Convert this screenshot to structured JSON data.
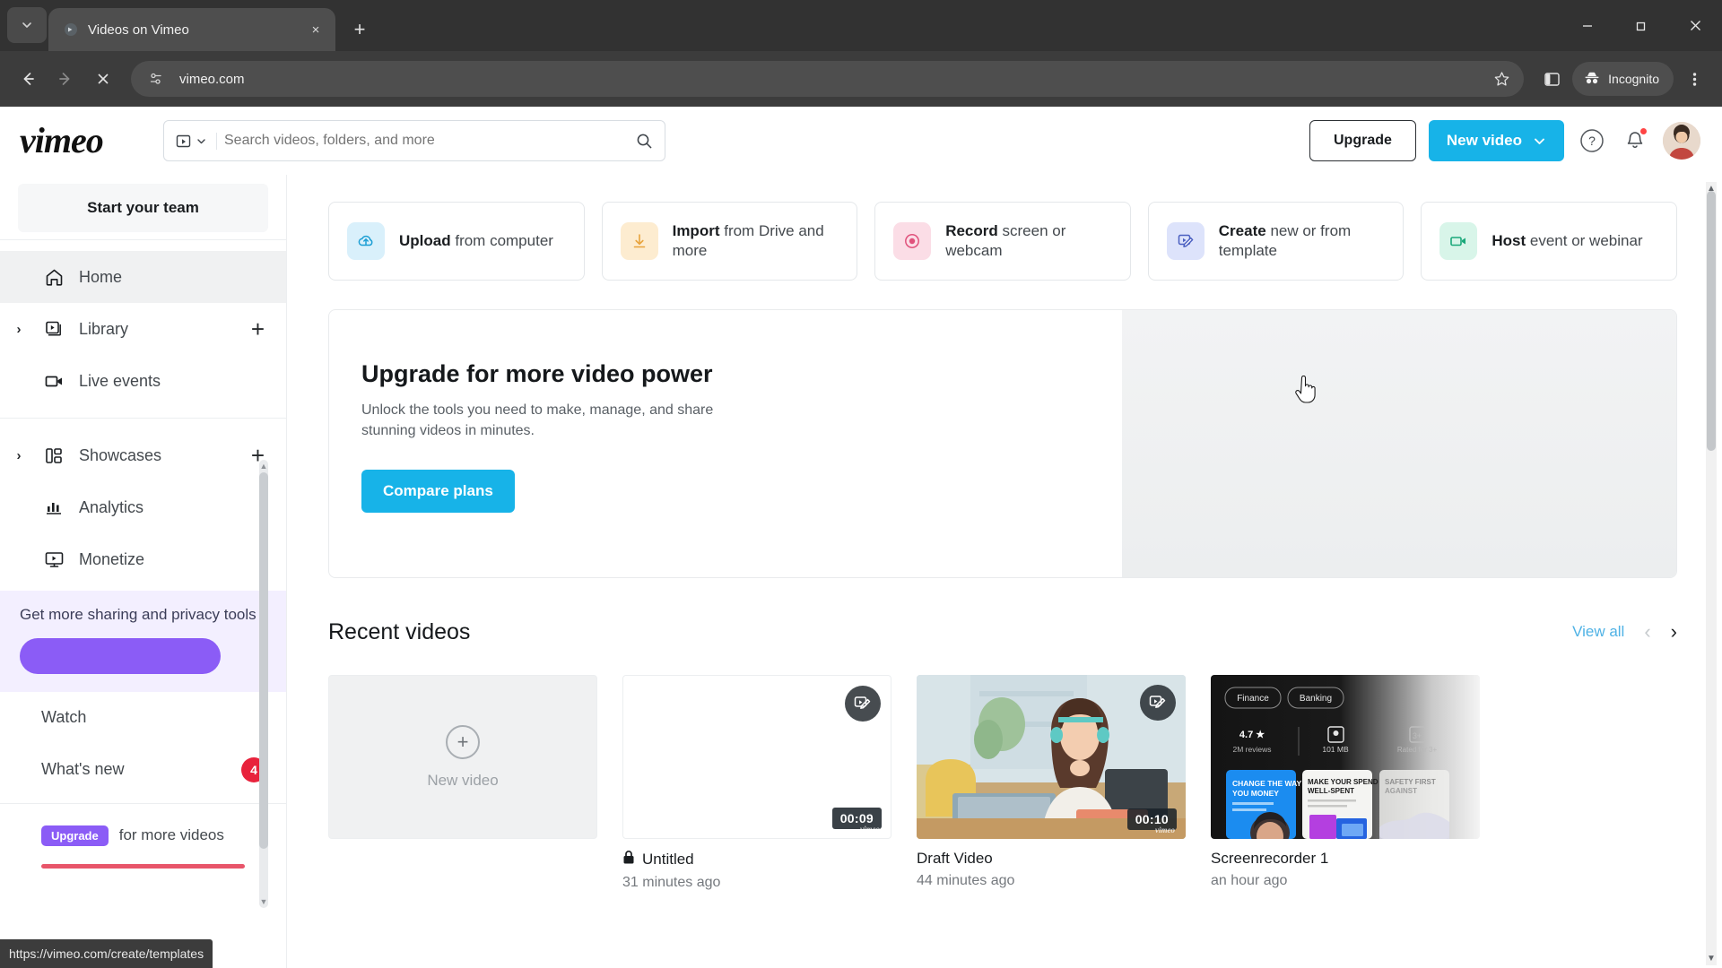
{
  "browser": {
    "tab": {
      "title": "Videos on Vimeo",
      "close_label": "×"
    },
    "new_tab_label": "+",
    "tab_search_label": "⌄",
    "window": {
      "minimize": "—",
      "maximize": "❐",
      "close": "✕"
    },
    "nav": {
      "back": "←",
      "forward": "→",
      "stop": "✕"
    },
    "omnibox": {
      "url": "vimeo.com",
      "site_info_icon": "site-settings-icon"
    },
    "toolbar": {
      "bookmark_icon": "star-icon",
      "sidepanel_icon": "side-panel-icon",
      "incognito_label": "Incognito",
      "menu_icon": "three-dot-menu-icon"
    },
    "status_url": "https://vimeo.com/create/templates"
  },
  "header": {
    "logo": "vimeo",
    "search": {
      "placeholder": "Search videos, folders, and more",
      "value": ""
    },
    "upgrade_label": "Upgrade",
    "new_video_label": "New video",
    "help_icon": "question-mark-icon",
    "notifications_icon": "bell-icon"
  },
  "sidebar": {
    "start_team_label": "Start your team",
    "items": [
      {
        "label": "Home",
        "icon": "home-icon",
        "active": true,
        "caret": false,
        "plus": false
      },
      {
        "label": "Library",
        "icon": "library-icon",
        "active": false,
        "caret": true,
        "plus": true
      },
      {
        "label": "Live events",
        "icon": "video-camera-icon",
        "active": false,
        "caret": false,
        "plus": false
      },
      {
        "label": "Showcases",
        "icon": "showcases-icon",
        "active": false,
        "caret": true,
        "plus": true
      },
      {
        "label": "Analytics",
        "icon": "bar-chart-icon",
        "active": false,
        "caret": false,
        "plus": false
      },
      {
        "label": "Monetize",
        "icon": "monetize-icon",
        "active": false,
        "caret": false,
        "plus": false
      }
    ],
    "promo": {
      "text": "Get more sharing and privacy tools"
    },
    "watch_label": "Watch",
    "whats_new_label": "What's new",
    "whats_new_badge": "4",
    "upgrade_chip": "Upgrade",
    "upgrade_text": "for more videos"
  },
  "main": {
    "action_cards": [
      {
        "bold": "Upload",
        "rest": "from computer",
        "icon": "cloud-upload-icon",
        "bg": "#d9f0fb",
        "fg": "#1b9ed4"
      },
      {
        "bold": "Import",
        "rest": "from Drive and more",
        "icon": "download-arrow-icon",
        "bg": "#fdecd0",
        "fg": "#e8a33c"
      },
      {
        "bold": "Record",
        "rest": "screen or webcam",
        "icon": "record-dot-icon",
        "bg": "#fbdde6",
        "fg": "#e0527c"
      },
      {
        "bold": "Create",
        "rest": "new or from template",
        "icon": "create-edit-icon",
        "bg": "#dde3fb",
        "fg": "#4a5fc1"
      },
      {
        "bold": "Host",
        "rest": "event or webinar",
        "icon": "webinar-camera-icon",
        "bg": "#d8f5e9",
        "fg": "#1aa87a"
      }
    ],
    "upgrade_banner": {
      "title": "Upgrade for more video power",
      "subtitle": "Unlock the tools you need to make, manage, and share stunning videos in minutes.",
      "cta": "Compare plans"
    },
    "recent": {
      "title": "Recent videos",
      "view_all": "View all",
      "prev_icon": "chevron-left-icon",
      "next_icon": "chevron-right-icon"
    },
    "videos": [
      {
        "kind": "new",
        "title": "New video",
        "time": "",
        "duration": "",
        "locked": false
      },
      {
        "kind": "blank",
        "title": "Untitled",
        "time": "31 minutes ago",
        "duration": "00:09",
        "locked": true
      },
      {
        "kind": "photo",
        "title": "Draft Video",
        "time": "44 minutes ago",
        "duration": "00:10",
        "locked": false
      },
      {
        "kind": "promo",
        "title": "Screenrecorder 1",
        "time": "an hour ago",
        "duration": "",
        "locked": false
      }
    ],
    "promo_thumb": {
      "chips": [
        "Finance",
        "Banking"
      ],
      "rating": "4.7",
      "rating_sub": "2M reviews",
      "size": "101 MB",
      "age": "Rated for 3+",
      "cards": [
        "CHANGE THE WAY YOU MONEY",
        "MAKE YOUR SPEND WELL-SPENT",
        "SAFETY FIRST AGAINST"
      ]
    }
  },
  "colors": {
    "brand_blue": "#17b3e8",
    "purple": "#8b5cf6",
    "badge_red": "#e8223c",
    "link_blue": "#4fb2e5"
  }
}
